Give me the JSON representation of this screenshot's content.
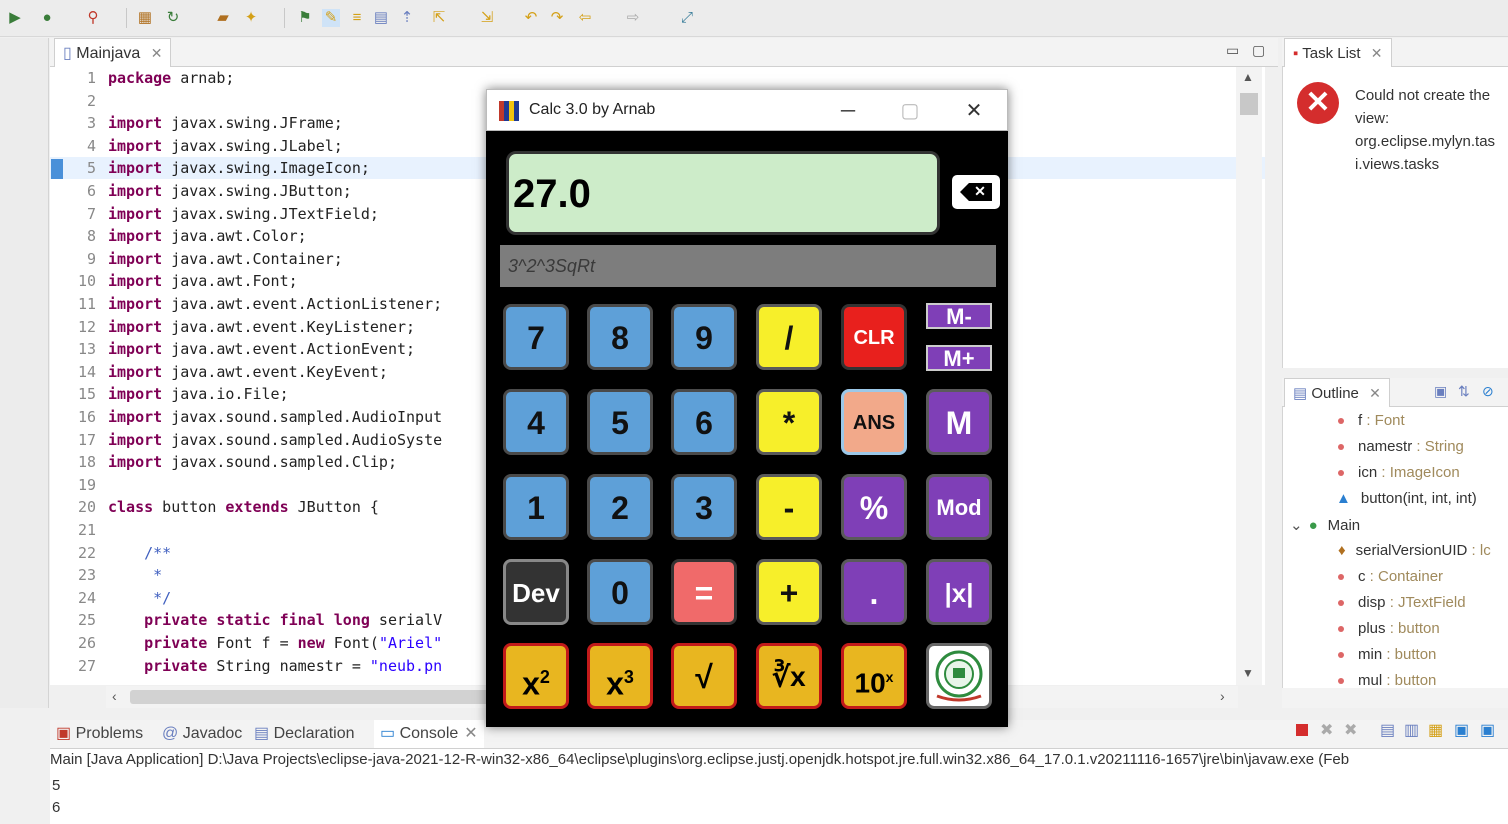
{
  "toolbar": {
    "icons": [
      "run-icon",
      "debug-icon",
      "search-icon",
      "package-icon",
      "refresh-icon",
      "folder-icon",
      "wand-icon",
      "pin-icon",
      "highlight-icon",
      "list-icon",
      "filter-icon",
      "nav-icon",
      "back-icon",
      "forward-icon",
      "prev-icon",
      "next-icon",
      "open-icon"
    ]
  },
  "editor": {
    "tab_label": "Mainjava",
    "lines": [
      {
        "n": "1",
        "parts": [
          [
            "kw",
            "package"
          ],
          [
            "t",
            " arnab;"
          ]
        ]
      },
      {
        "n": "2",
        "parts": []
      },
      {
        "n": "3",
        "parts": [
          [
            "kw",
            "import"
          ],
          [
            "t",
            " javax.swing.JFrame;"
          ]
        ]
      },
      {
        "n": "4",
        "parts": [
          [
            "kw",
            "import"
          ],
          [
            "t",
            " javax.swing.JLabel;"
          ]
        ]
      },
      {
        "n": "5",
        "parts": [
          [
            "kw",
            "import"
          ],
          [
            "t",
            " javax.swing.ImageIcon;"
          ]
        ]
      },
      {
        "n": "6",
        "parts": [
          [
            "kw",
            "import"
          ],
          [
            "t",
            " javax.swing.JButton;"
          ]
        ]
      },
      {
        "n": "7",
        "parts": [
          [
            "kw",
            "import"
          ],
          [
            "t",
            " javax.swing.JTextField;"
          ]
        ]
      },
      {
        "n": "8",
        "parts": [
          [
            "kw",
            "import"
          ],
          [
            "t",
            " java.awt.Color;"
          ]
        ]
      },
      {
        "n": "9",
        "parts": [
          [
            "kw",
            "import"
          ],
          [
            "t",
            " java.awt.Container;"
          ]
        ]
      },
      {
        "n": "10",
        "parts": [
          [
            "kw",
            "import"
          ],
          [
            "t",
            " java.awt.Font;"
          ]
        ]
      },
      {
        "n": "11",
        "parts": [
          [
            "kw",
            "import"
          ],
          [
            "t",
            " java.awt.event.ActionListener;"
          ]
        ]
      },
      {
        "n": "12",
        "parts": [
          [
            "kw",
            "import"
          ],
          [
            "t",
            " java.awt.event.KeyListener;"
          ]
        ]
      },
      {
        "n": "13",
        "parts": [
          [
            "kw",
            "import"
          ],
          [
            "t",
            " java.awt.event.ActionEvent;"
          ]
        ]
      },
      {
        "n": "14",
        "parts": [
          [
            "kw",
            "import"
          ],
          [
            "t",
            " java.awt.event.KeyEvent;"
          ]
        ]
      },
      {
        "n": "15",
        "parts": [
          [
            "kw",
            "import"
          ],
          [
            "t",
            " java.io.File;"
          ]
        ]
      },
      {
        "n": "16",
        "parts": [
          [
            "kw",
            "import"
          ],
          [
            "t",
            " javax.sound.sampled.AudioInput"
          ]
        ]
      },
      {
        "n": "17",
        "parts": [
          [
            "kw",
            "import"
          ],
          [
            "t",
            " javax.sound.sampled.AudioSyste"
          ]
        ]
      },
      {
        "n": "18",
        "parts": [
          [
            "kw",
            "import"
          ],
          [
            "t",
            " javax.sound.sampled.Clip;"
          ]
        ]
      },
      {
        "n": "19",
        "parts": []
      },
      {
        "n": "20",
        "parts": [
          [
            "kw",
            "class"
          ],
          [
            "t",
            " button "
          ],
          [
            "kw",
            "extends"
          ],
          [
            "t",
            " JButton {"
          ]
        ]
      },
      {
        "n": "21",
        "parts": []
      },
      {
        "n": "22",
        "parts": [
          [
            "cmt",
            "    /**"
          ]
        ]
      },
      {
        "n": "23",
        "parts": [
          [
            "cmt",
            "     *"
          ]
        ]
      },
      {
        "n": "24",
        "parts": [
          [
            "cmt",
            "     */"
          ]
        ]
      },
      {
        "n": "25",
        "parts": [
          [
            "t",
            "    "
          ],
          [
            "kw",
            "private static final long"
          ],
          [
            "t",
            " serialV"
          ]
        ]
      },
      {
        "n": "26",
        "parts": [
          [
            "t",
            "    "
          ],
          [
            "kw",
            "private"
          ],
          [
            "t",
            " Font f = "
          ],
          [
            "kw",
            "new"
          ],
          [
            "t",
            " Font("
          ],
          [
            "str",
            "\"Ariel\""
          ]
        ]
      },
      {
        "n": "27",
        "parts": [
          [
            "t",
            "    "
          ],
          [
            "kw",
            "private"
          ],
          [
            "t",
            " String namestr = "
          ],
          [
            "str",
            "\"neub.pn"
          ]
        ]
      }
    ]
  },
  "tasklist": {
    "tab_label": "Task List",
    "error_lines": [
      "Could not create the",
      "view:",
      "org.eclipse.mylyn.tas",
      "i.views.tasks"
    ]
  },
  "outline": {
    "tab_label": "Outline",
    "items": [
      {
        "name": "f",
        "type": " : Font"
      },
      {
        "name": "namestr",
        "type": " : String"
      },
      {
        "name": "icn",
        "type": " : ImageIcon"
      },
      {
        "name": "button(int, int, int)",
        "type": ""
      },
      {
        "name": "Main",
        "type": ""
      },
      {
        "name": "serialVersionUID",
        "type": " : lc"
      },
      {
        "name": "c",
        "type": " : Container"
      },
      {
        "name": "disp",
        "type": " : JTextField"
      },
      {
        "name": "plus",
        "type": " : button"
      },
      {
        "name": "min",
        "type": " : button"
      },
      {
        "name": "mul",
        "type": " : button"
      }
    ]
  },
  "bottom": {
    "tabs": [
      "Problems",
      "Javadoc",
      "Declaration",
      "Console"
    ],
    "console_header": "Main [Java Application] D:\\Java Projects\\eclipse-java-2021-12-R-win32-x86_64\\eclipse\\plugins\\org.eclipse.justj.openjdk.hotspot.jre.full.win32.x86_64_17.0.1.v20211116-1657\\jre\\bin\\javaw.exe  (Feb",
    "console_lines": [
      "5",
      "6"
    ]
  },
  "calc": {
    "title": "Calc 3.0 by Arnab",
    "display": "27.0",
    "history": "3^2^3SqRt",
    "keys": {
      "k7": "7",
      "k8": "8",
      "k9": "9",
      "div": "/",
      "clr": "CLR",
      "mminus": "M-",
      "mplus": "M+",
      "k4": "4",
      "k5": "5",
      "k6": "6",
      "mul": "*",
      "ans": "ANS",
      "m": "M",
      "k1": "1",
      "k2": "2",
      "k3": "3",
      "sub": "-",
      "pct": "%",
      "mod": "Mod",
      "dev": "Dev",
      "k0": "0",
      "eq": "=",
      "add": "+",
      "dot": ".",
      "abs": "|x|",
      "sq_base": "x",
      "sq_exp": "2",
      "cube_base": "x",
      "cube_exp": "3",
      "sqrt": "√",
      "cbrt": "∛x",
      "pow10_base": "10",
      "pow10_exp": "x"
    }
  }
}
